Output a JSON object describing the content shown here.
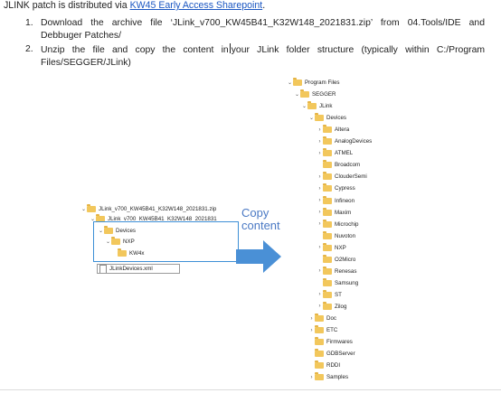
{
  "intro": {
    "prefix": "JLINK patch is distributed via ",
    "link": "KW45 Early Access Sharepoint",
    "suffix": "."
  },
  "steps": [
    {
      "num": "1.",
      "text": "Download the archive file ‘JLink_v700_KW45B41_K32W148_2021831.zip’ from 04.Tools/IDE and Debbuger Patches/"
    },
    {
      "num": "2.",
      "text_a": "Unzip the file and copy the content in",
      "text_b": "your JLink folder structure (typically within C:/Program Files/SEGGER/JLink)"
    }
  ],
  "left_tree": {
    "zip": "JLink_v700_KW45B41_K32W148_2021831.zip",
    "root": "JLink_v700_KW45B41_K32W148_2021831",
    "devices": "Devices",
    "nxp": "NXP",
    "kw4x": "KW4x",
    "xml": "JLinkDevices.xml"
  },
  "copy_label": {
    "line1": "Copy",
    "line2": "content"
  },
  "right_tree": {
    "program_files": "Program Files",
    "segger": "SEGGER",
    "jlink": "JLink",
    "devices": "Devices",
    "vendors": [
      "Altera",
      "AnalogDevices",
      "ATMEL",
      "Broadcom",
      "ClouderSemi",
      "Cypress",
      "Infineon",
      "Maxim",
      "Microchip",
      "Nuvoton",
      "NXP",
      "O2Micro",
      "Renesas",
      "Samsung",
      "ST",
      "Zilog"
    ],
    "after": [
      "Doc",
      "ETC",
      "Firmwares",
      "GDBServer",
      "RDDI",
      "Samples"
    ]
  },
  "colors": {
    "link": "#1a56c2",
    "highlight": "#3d8fd6",
    "arrow": "#4a90d6",
    "folder": "#f2c75c"
  }
}
